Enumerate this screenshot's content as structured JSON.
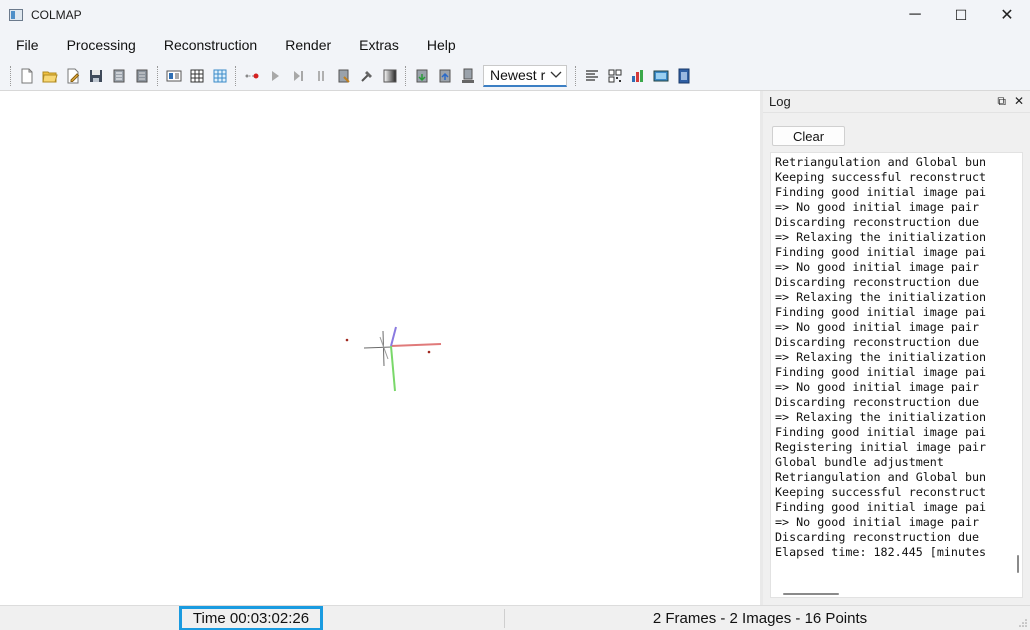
{
  "window": {
    "title": "COLMAP",
    "controls": [
      "─",
      "☐",
      "✕"
    ]
  },
  "menu": {
    "items": [
      "File",
      "Processing",
      "Reconstruction",
      "Render",
      "Extras",
      "Help"
    ]
  },
  "toolbar": {
    "groups": [
      [
        "new-project-icon",
        "open-project-icon",
        "edit-project-icon",
        "save-project-icon",
        "import-icon",
        "export-icon"
      ],
      [
        "feature-extraction-icon",
        "feature-matching-icon",
        "database-management-icon"
      ],
      [
        "automatic-reconstruction-icon",
        "start-reconstruction-icon",
        "step-reconstruction-icon",
        "pause-reconstruction-icon",
        "reset-reconstruction-icon",
        "bundle-adjustment-icon",
        "render-options-icon"
      ],
      [
        "import-model-icon",
        "export-model-icon",
        "export-all-icon"
      ],
      [
        "log-icon",
        "match-matrix-icon",
        "reconstruction-stats-icon",
        "dense-reconstruction-icon",
        "render-video-icon"
      ]
    ],
    "reconstruction_select": {
      "value": "Newest r"
    }
  },
  "log": {
    "title": "Log",
    "float_icon": "⧉",
    "close_icon": "✕",
    "clear_label": "Clear",
    "lines": [
      "Retriangulation and Global bun",
      "Keeping successful reconstruct",
      "Finding good initial image pai",
      "=> No good initial image pair",
      "Discarding reconstruction due",
      "=> Relaxing the initialization",
      "Finding good initial image pai",
      "=> No good initial image pair",
      "Discarding reconstruction due",
      "=> Relaxing the initialization",
      "Finding good initial image pai",
      "=> No good initial image pair",
      "Discarding reconstruction due",
      "=> Relaxing the initialization",
      "Finding good initial image pai",
      "=> No good initial image pair",
      "Discarding reconstruction due",
      "=> Relaxing the initialization",
      "Finding good initial image pai",
      "Registering initial image pair",
      "Global bundle adjustment",
      "Retriangulation and Global bun",
      "Keeping successful reconstruct",
      "Finding good initial image pai",
      "=> No good initial image pair",
      "Discarding reconstruction due",
      "Elapsed time: 182.445 [minutes"
    ]
  },
  "status": {
    "time": "Time 00:03:02:26",
    "counts": "2 Frames - 2 Images - 16 Points"
  },
  "colors": {
    "highlight": "#1a9be0",
    "axis_x": "#e07a7a",
    "axis_y": "#7ad86a",
    "axis_z": "#8a7ae0",
    "point": "#a0281e"
  }
}
